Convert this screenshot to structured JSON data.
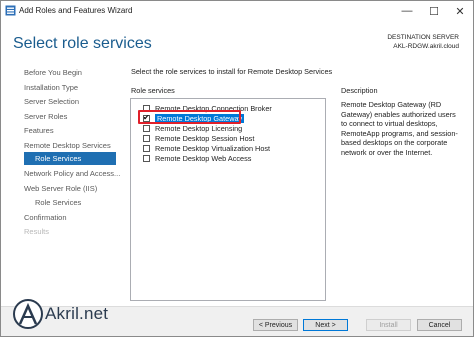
{
  "window": {
    "title": "Add Roles and Features Wizard",
    "minimize_glyph": "—",
    "maximize_glyph": "☐",
    "close_glyph": "✕"
  },
  "header": {
    "page_title": "Select role services",
    "destination_label": "DESTINATION SERVER",
    "destination_server": "AKL-RDGW.akril.cloud"
  },
  "nav": {
    "items": [
      {
        "label": "Before You Begin",
        "state": "normal"
      },
      {
        "label": "Installation Type",
        "state": "normal"
      },
      {
        "label": "Server Selection",
        "state": "normal"
      },
      {
        "label": "Server Roles",
        "state": "normal"
      },
      {
        "label": "Features",
        "state": "normal"
      },
      {
        "label": "Remote Desktop Services",
        "state": "normal"
      },
      {
        "label": "Role Services",
        "state": "active"
      },
      {
        "label": "Network Policy and Access...",
        "state": "normal"
      },
      {
        "label": "Web Server Role (IIS)",
        "state": "normal"
      },
      {
        "label": "Role Services",
        "state": "normal"
      },
      {
        "label": "Confirmation",
        "state": "normal"
      },
      {
        "label": "Results",
        "state": "disabled"
      }
    ]
  },
  "main": {
    "instruction": "Select the role services to install for Remote Desktop Services",
    "role_services_label": "Role services",
    "description_label": "Description",
    "services": [
      {
        "label": "Remote Desktop Connection Broker",
        "checked": false,
        "selected": false
      },
      {
        "label": "Remote Desktop Gateway",
        "checked": true,
        "selected": true
      },
      {
        "label": "Remote Desktop Licensing",
        "checked": false,
        "selected": false
      },
      {
        "label": "Remote Desktop Session Host",
        "checked": false,
        "selected": false
      },
      {
        "label": "Remote Desktop Virtualization Host",
        "checked": false,
        "selected": false
      },
      {
        "label": "Remote Desktop Web Access",
        "checked": false,
        "selected": false
      }
    ],
    "description": "Remote Desktop Gateway (RD Gateway) enables authorized users to connect to virtual desktops, RemoteApp programs, and session-based desktops on the corporate network or over the Internet."
  },
  "footer": {
    "previous_label": "< Previous",
    "next_label": "Next >",
    "install_label": "Install",
    "cancel_label": "Cancel"
  },
  "watermark": {
    "text": "Akril.net"
  },
  "colors": {
    "accent": "#1f6fb2",
    "title_blue": "#1a5c8e",
    "highlight_red": "#e0202a",
    "selection_blue": "#0078d7"
  }
}
